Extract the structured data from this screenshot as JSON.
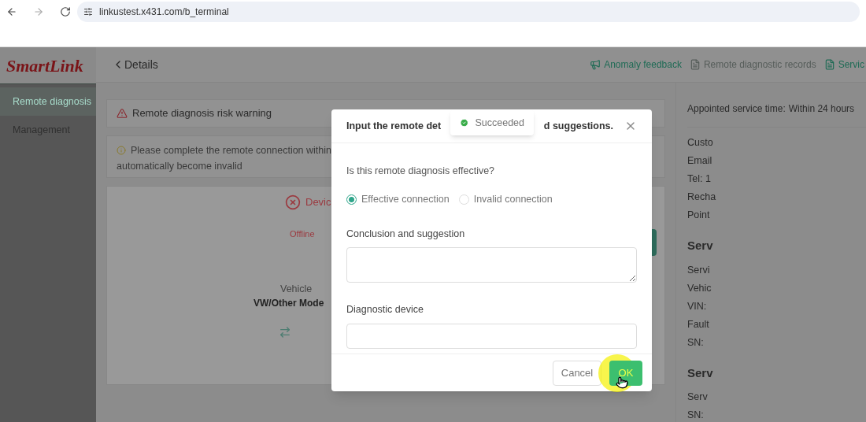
{
  "browser": {
    "url": "linkustest.x431.com/b_terminal"
  },
  "sidebar": {
    "logo": "SmartLink",
    "items": [
      {
        "label": "Remote diagnosis",
        "selected": true
      },
      {
        "label": "Management",
        "selected": false
      }
    ]
  },
  "header": {
    "back": "Details",
    "actions": [
      {
        "label": "Anomaly feedback",
        "disabled": false,
        "kind": "feedback"
      },
      {
        "label": "Remote diagnostic records",
        "disabled": true,
        "kind": "records"
      },
      {
        "label": "Servic",
        "disabled": false,
        "kind": "records"
      }
    ]
  },
  "risk_warning": "Remote diagnosis risk warning",
  "notice": [
    "Please complete the remote connection within",
    "automatically become invalid"
  ],
  "device": {
    "status_title": "Devic",
    "status": "Offline",
    "vehicle_label": "Vehicle",
    "vehicle": "VW/Other Mode"
  },
  "details": {
    "appointed_label": "Appointed service time:",
    "appointed_value": "Within 24 hours",
    "rows": [
      "Custo",
      "Email",
      "Tel:  1",
      "Recha",
      "Point"
    ],
    "sections": [
      {
        "title": "Serv",
        "rows": [
          "Servi",
          "Vehic",
          "VIN:",
          "Fault",
          "SN:"
        ]
      },
      {
        "title": "Serv",
        "rows": [
          "Serv",
          "SN:"
        ]
      }
    ]
  },
  "dialog": {
    "title_start": "Input the remote det",
    "title_end": "d suggestions.",
    "question": "Is this remote diagnosis effective?",
    "options": [
      {
        "label": "Effective connection",
        "selected": true
      },
      {
        "label": "Invalid connection",
        "selected": false
      }
    ],
    "fields": [
      {
        "label": "Conclusion and suggestion",
        "kind": "textarea"
      },
      {
        "label": "Diagnostic device",
        "kind": "input"
      }
    ],
    "buttons": [
      {
        "label": "Cancel",
        "kind": "secondary"
      },
      {
        "label": "OK",
        "kind": "primary"
      }
    ]
  },
  "toast": {
    "message": "Succeeded",
    "kind": "success"
  }
}
